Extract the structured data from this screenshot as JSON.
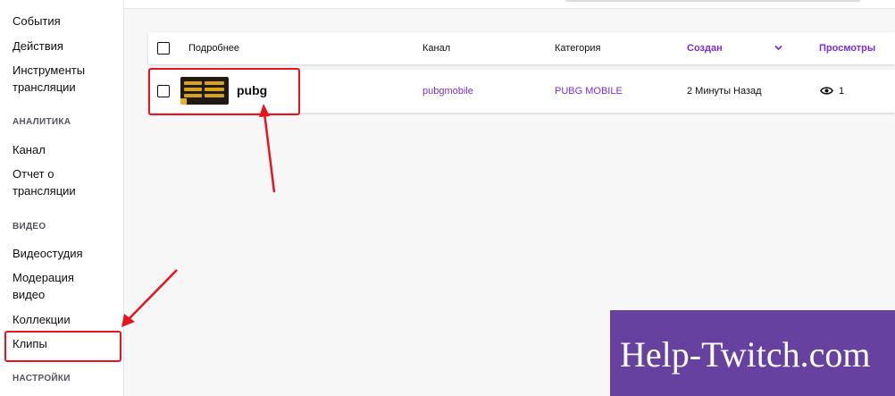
{
  "sidebar": {
    "items_top": [
      "События",
      "Действия"
    ],
    "broadcast_tools": [
      "Инструменты",
      "трансляции"
    ],
    "analytics_header": "АНАЛИТИКА",
    "channel": "Канал",
    "broadcast_report": [
      "Отчет о",
      "трансляции"
    ],
    "video_header": "ВИДЕО",
    "video_studio": "Видеостудия",
    "video_moderation": [
      "Модерация",
      "видео"
    ],
    "collections": "Коллекции",
    "clips": "Клипы",
    "settings_header": "НАСТРОЙКИ"
  },
  "table": {
    "headers": {
      "details": "Подробнее",
      "channel": "Канал",
      "category": "Категория",
      "created": "Создан",
      "views": "Просмотры"
    },
    "rows": [
      {
        "title": "pubg",
        "channel": "pubgmobile",
        "category": "PUBG MOBILE",
        "created": "2 Минуты Назад",
        "views": "1"
      }
    ]
  },
  "icons": {
    "sort": "chevron-down-icon",
    "views": "eye-icon"
  },
  "colors": {
    "accent": "#772ce8",
    "highlight": "#e8131b",
    "watermark_bg": "#6641a0"
  },
  "watermark": {
    "text": "Help-Twitch.com"
  }
}
